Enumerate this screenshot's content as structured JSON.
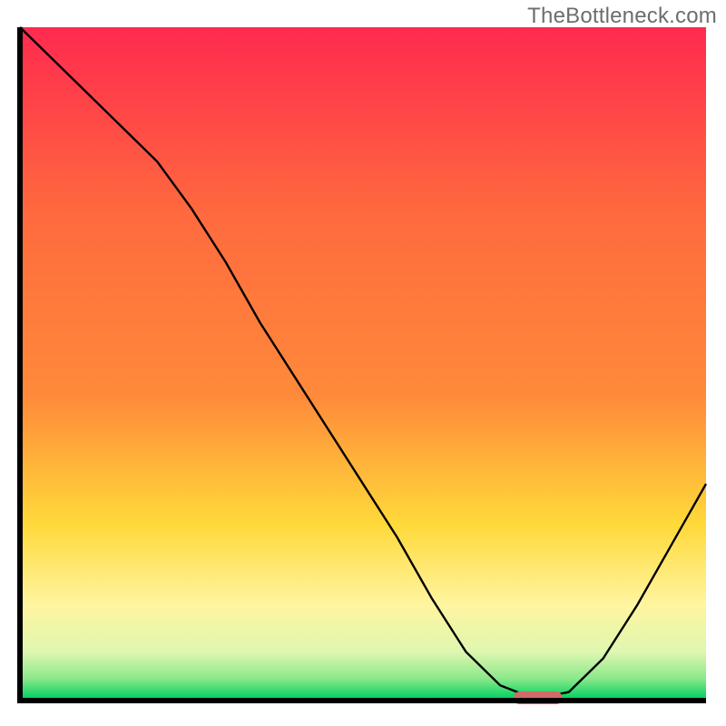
{
  "watermark": "TheBottleneck.com",
  "chart_data": {
    "type": "line",
    "title": "",
    "xlabel": "",
    "ylabel": "",
    "xlim": [
      0,
      100
    ],
    "ylim": [
      0,
      100
    ],
    "x": [
      0,
      5,
      10,
      15,
      20,
      25,
      30,
      35,
      40,
      45,
      50,
      55,
      60,
      65,
      70,
      75,
      80,
      85,
      90,
      95,
      100
    ],
    "values": [
      100,
      95,
      90,
      85,
      80,
      73,
      65,
      56,
      48,
      40,
      32,
      24,
      15,
      7,
      2,
      0,
      1,
      6,
      14,
      23,
      32
    ],
    "marker_x_range": [
      72,
      79
    ],
    "marker_y": 0,
    "colors": {
      "gradient_top": "#ff2a4f",
      "gradient_mid_upper": "#ff8a3a",
      "gradient_mid": "#ffd93a",
      "gradient_lower": "#fff5a0",
      "gradient_low": "#dff7b0",
      "gradient_bottom": "#00d060",
      "axis": "#000000",
      "curve": "#000000",
      "marker": "#d16a6a"
    }
  }
}
